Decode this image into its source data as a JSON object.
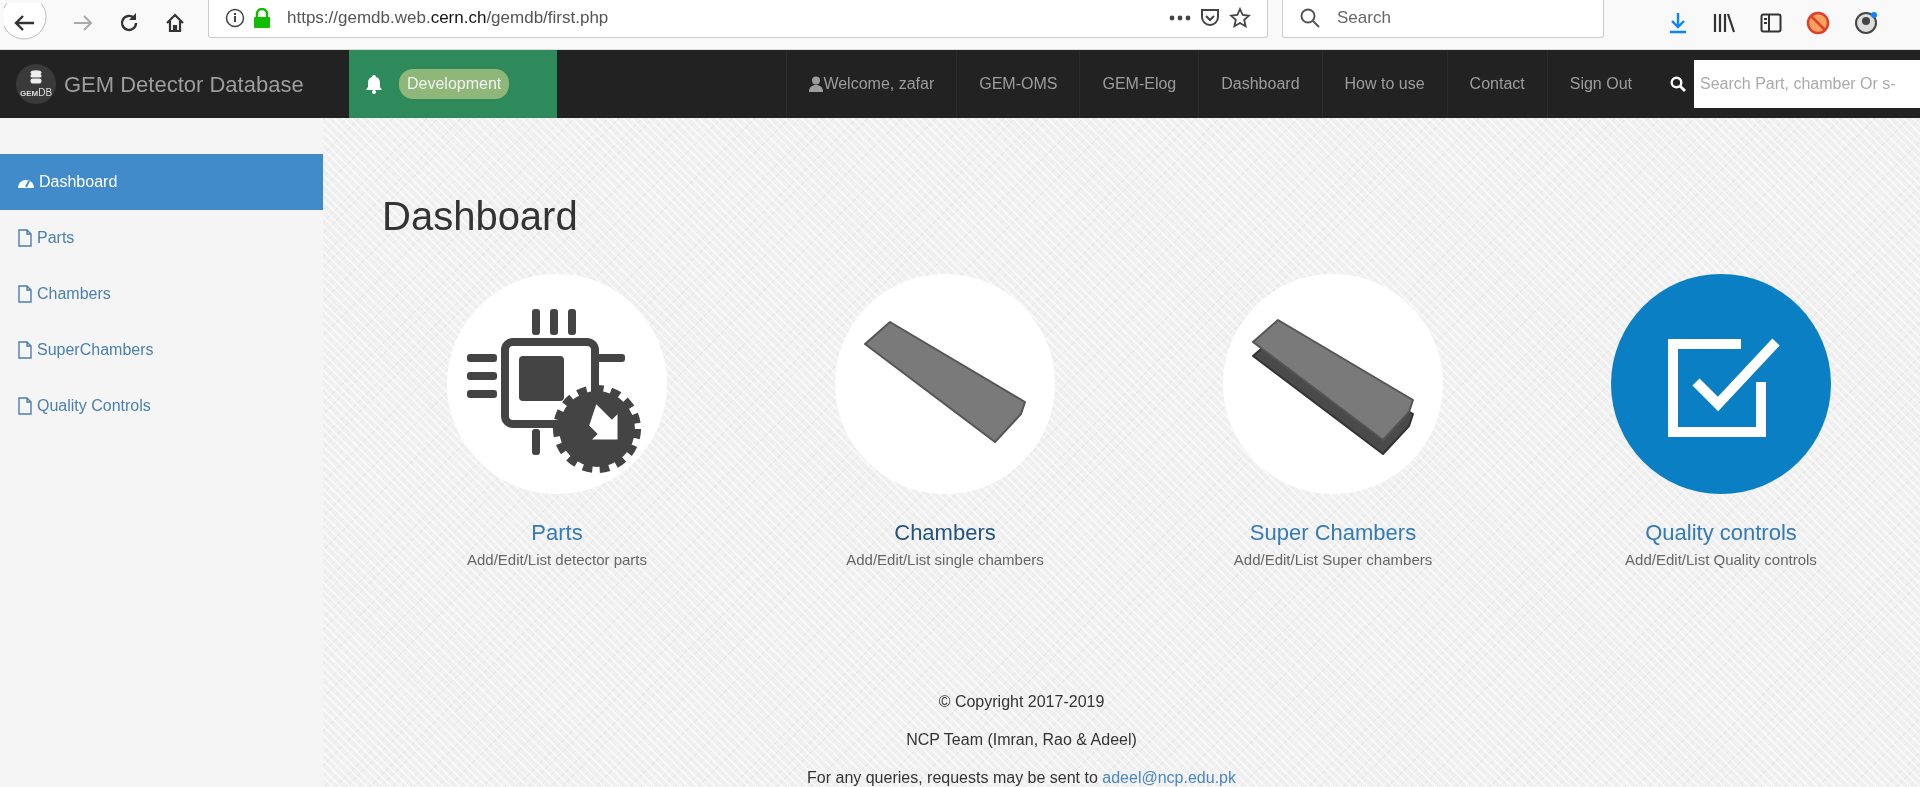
{
  "browser": {
    "url": "https://gemdb.web.**cern.ch**/gemdb/first.php",
    "search_placeholder": "Search"
  },
  "navbar": {
    "logo_text": [
      "GEM",
      "DB"
    ],
    "brand": "GEM Detector Database",
    "badge": "Development",
    "links": [
      {
        "kind": "user",
        "label": "Welcome, zafar"
      },
      {
        "kind": "link",
        "label": "GEM-OMS"
      },
      {
        "kind": "link",
        "label": "GEM-Elog"
      },
      {
        "kind": "link",
        "label": "Dashboard"
      },
      {
        "kind": "link",
        "label": "How to use"
      },
      {
        "kind": "link",
        "label": "Contact"
      },
      {
        "kind": "link",
        "label": "Sign Out"
      }
    ],
    "search_placeholder": "Search Part, chamber Or s-"
  },
  "sidebar": {
    "items": [
      {
        "kind": "dashboard",
        "label": "Dashboard",
        "selected": true
      },
      {
        "kind": "page",
        "label": "Parts",
        "selected": false
      },
      {
        "kind": "page",
        "label": "Chambers",
        "selected": false
      },
      {
        "kind": "page",
        "label": "SuperChambers",
        "selected": false
      },
      {
        "kind": "page",
        "label": "Quality Controls",
        "selected": false
      }
    ]
  },
  "main": {
    "title": "Dashboard",
    "cards": [
      {
        "kind": "parts",
        "title": "Parts",
        "subtitle": "Add/Edit/List detector parts",
        "color": "#337ab7"
      },
      {
        "kind": "chamber",
        "title": "Chambers",
        "subtitle": "Add/Edit/List single chambers",
        "color": "#23527c"
      },
      {
        "kind": "superchamber",
        "title": "Super Chambers",
        "subtitle": "Add/Edit/List Super chambers",
        "color": "#337ab7"
      },
      {
        "kind": "qc",
        "title": "Quality controls",
        "subtitle": "Add/Edit/List Quality controls",
        "color": "#337ab7"
      }
    ]
  },
  "footer": {
    "copyright": "© Copyright 2017-2019",
    "team": "NCP Team (Imran, Rao & Adeel)",
    "contact_text": "For any queries, requests may be sent to",
    "email": "adeel@ncp.edu.pk"
  }
}
